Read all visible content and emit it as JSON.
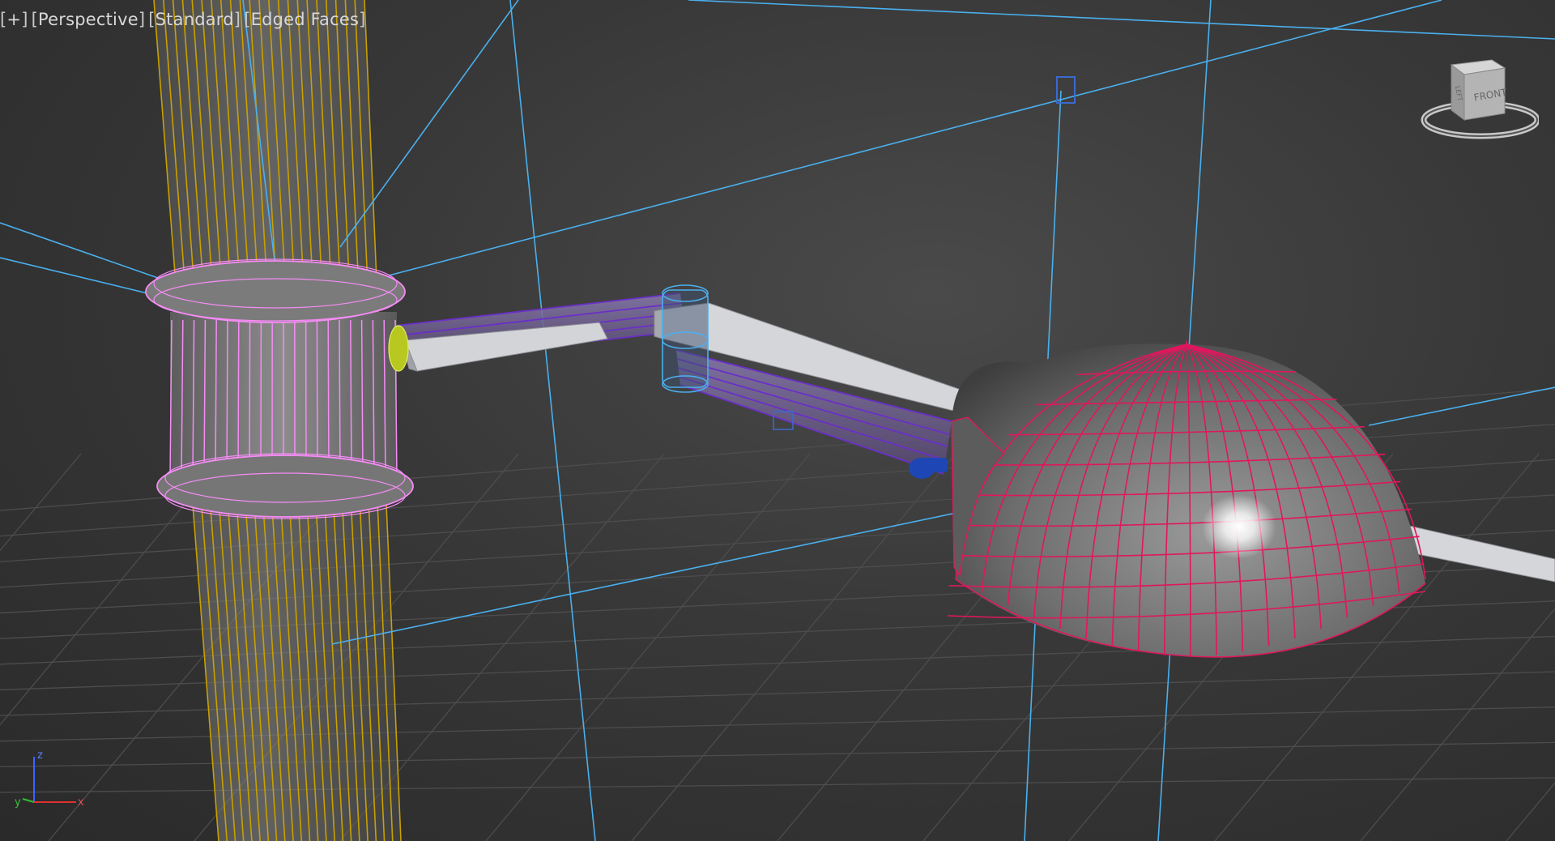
{
  "viewport": {
    "labels": [
      {
        "id": "menu",
        "text": "+"
      },
      {
        "id": "view",
        "text": "Perspective"
      },
      {
        "id": "shading",
        "text": "Standard"
      },
      {
        "id": "display",
        "text": "Edged Faces"
      }
    ]
  },
  "viewcube": {
    "face_front": "FRONT",
    "face_side": "LEFT"
  },
  "axis_tripod": {
    "x_label": "x",
    "y_label": "y",
    "z_label": "z"
  },
  "colors": {
    "background": "#363636",
    "grid_line": "#555555",
    "pole_wire": "#c9a000",
    "collar_wire": "#f58cf5",
    "arm_wire": "#6a2fc8",
    "dome_wire": "#e0175e",
    "light_line": "#4ab0ee",
    "blade_fill": "#d2d4d8",
    "mesh_fill": "#777777",
    "helper_dark_blue": "#1e46b4",
    "helper_yellow_green": "#c8d800"
  }
}
